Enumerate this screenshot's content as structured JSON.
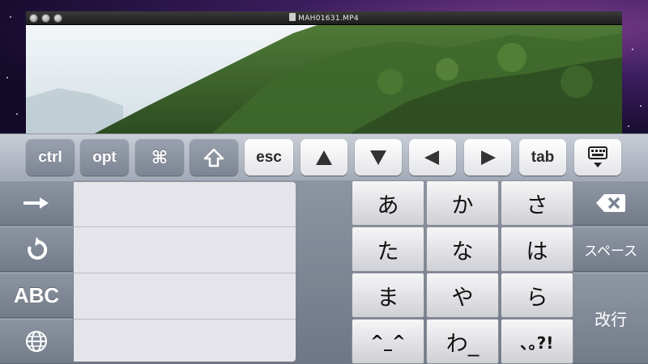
{
  "window": {
    "title": "MAH01631.MP4",
    "file_icon": "video-file-icon"
  },
  "toolbar": {
    "keys": [
      {
        "label": "ctrl"
      },
      {
        "label": "opt"
      },
      {
        "label": "⌘"
      },
      {
        "label": "⇧"
      },
      {
        "label": "esc"
      },
      {
        "label": "▲"
      },
      {
        "label": "▼"
      },
      {
        "label": "◀"
      },
      {
        "label": "▶"
      },
      {
        "label": "tab"
      },
      {
        "label": "⌨▼"
      }
    ]
  },
  "side_keys": {
    "arrow_icon": "→",
    "undo_icon": "undo-icon",
    "abc_label": "ABC",
    "globe_icon": "globe-icon"
  },
  "kana_keys": {
    "row1": [
      "あ",
      "か",
      "さ"
    ],
    "row2": [
      "た",
      "な",
      "は"
    ],
    "row3": [
      "ま",
      "や",
      "ら"
    ],
    "row4": [
      "^_^",
      "わ_",
      "､｡?!"
    ]
  },
  "right_keys": {
    "delete_icon": "delete-backspace-icon",
    "space_label": "スペース",
    "enter_label": "改行"
  },
  "colors": {
    "dark_key": "#7d8594",
    "light_key": "#e3e4e8",
    "candidate_bg": "#e5e4ea"
  }
}
